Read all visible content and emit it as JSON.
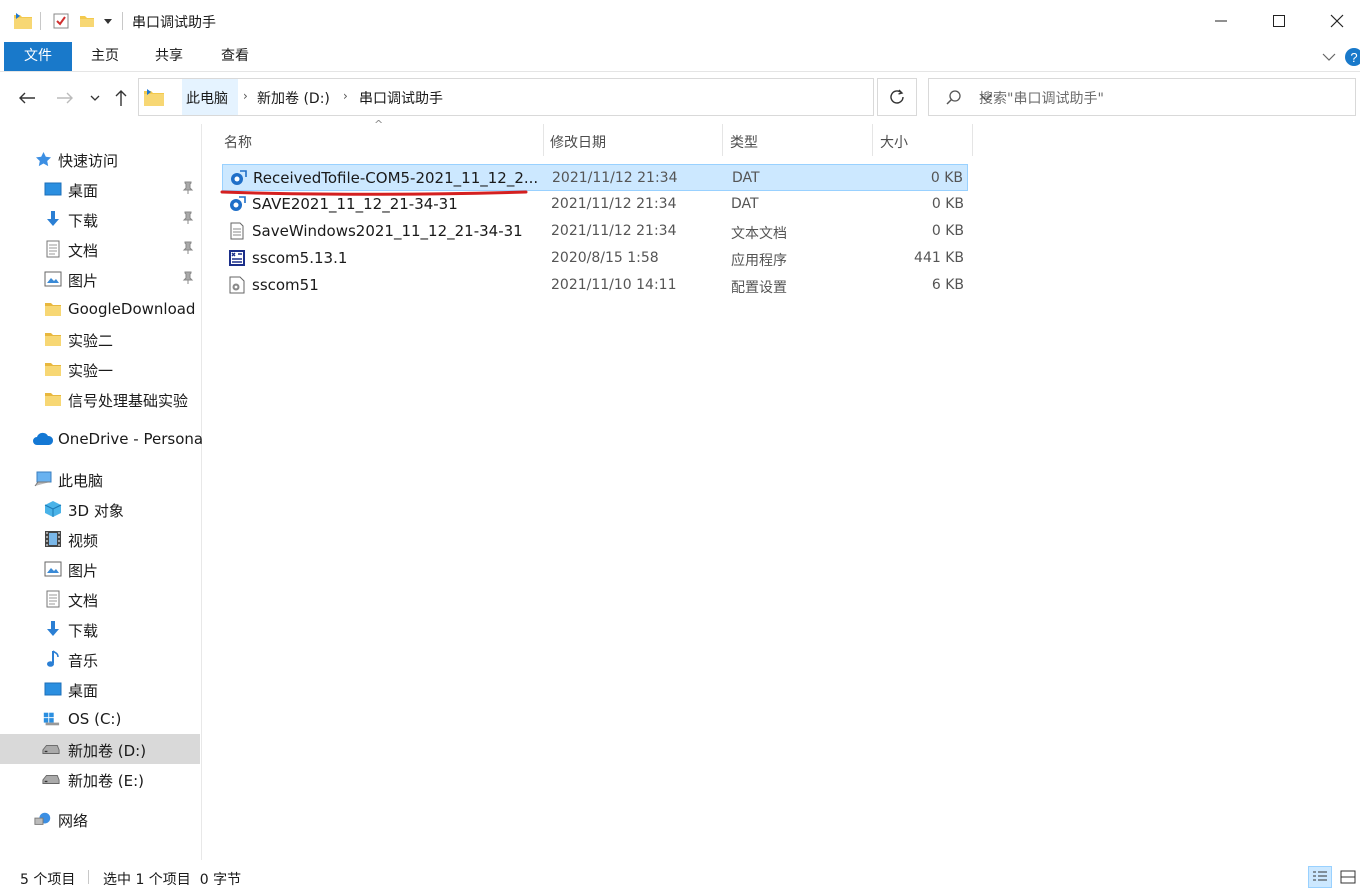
{
  "window": {
    "title": "串口调试助手"
  },
  "ribbon": {
    "tabs": [
      "文件",
      "主页",
      "共享",
      "查看"
    ]
  },
  "address": {
    "crumbs": [
      "此电脑",
      "新加卷 (D:)",
      "串口调试助手"
    ]
  },
  "search": {
    "placeholder": "搜索\"串口调试助手\""
  },
  "nav": {
    "quick_access": "快速访问",
    "quick_items": [
      "桌面",
      "下载",
      "文档",
      "图片",
      "GoogleDownload",
      "实验二",
      "实验一",
      "信号处理基础实验"
    ],
    "onedrive": "OneDrive - Persona",
    "this_pc": "此电脑",
    "pc_items": [
      "3D 对象",
      "视频",
      "图片",
      "文档",
      "下载",
      "音乐",
      "桌面",
      "OS (C:)",
      "新加卷 (D:)",
      "新加卷 (E:)"
    ],
    "network": "网络"
  },
  "columns": {
    "name": "名称",
    "date": "修改日期",
    "type": "类型",
    "size": "大小"
  },
  "files": [
    {
      "name": "ReceivedTofile-COM5-2021_11_12_2...",
      "date": "2021/11/12 21:34",
      "type": "DAT",
      "size": "0 KB",
      "icon": "dat-file-icon"
    },
    {
      "name": "SAVE2021_11_12_21-34-31",
      "date": "2021/11/12 21:34",
      "type": "DAT",
      "size": "0 KB",
      "icon": "dat-file-icon"
    },
    {
      "name": "SaveWindows2021_11_12_21-34-31",
      "date": "2021/11/12 21:34",
      "type": "文本文档",
      "size": "0 KB",
      "icon": "text-file-icon"
    },
    {
      "name": "sscom5.13.1",
      "date": "2020/8/15 1:58",
      "type": "应用程序",
      "size": "441 KB",
      "icon": "exe-file-icon"
    },
    {
      "name": "sscom51",
      "date": "2021/11/10 14:11",
      "type": "配置设置",
      "size": "6 KB",
      "icon": "ini-file-icon"
    }
  ],
  "status": {
    "count": "5 个项目",
    "selection": "选中 1 个项目  0 字节"
  },
  "colors": {
    "accent": "#1979ca",
    "selection_bg": "#cce8ff",
    "annotation_red": "#d42020"
  }
}
